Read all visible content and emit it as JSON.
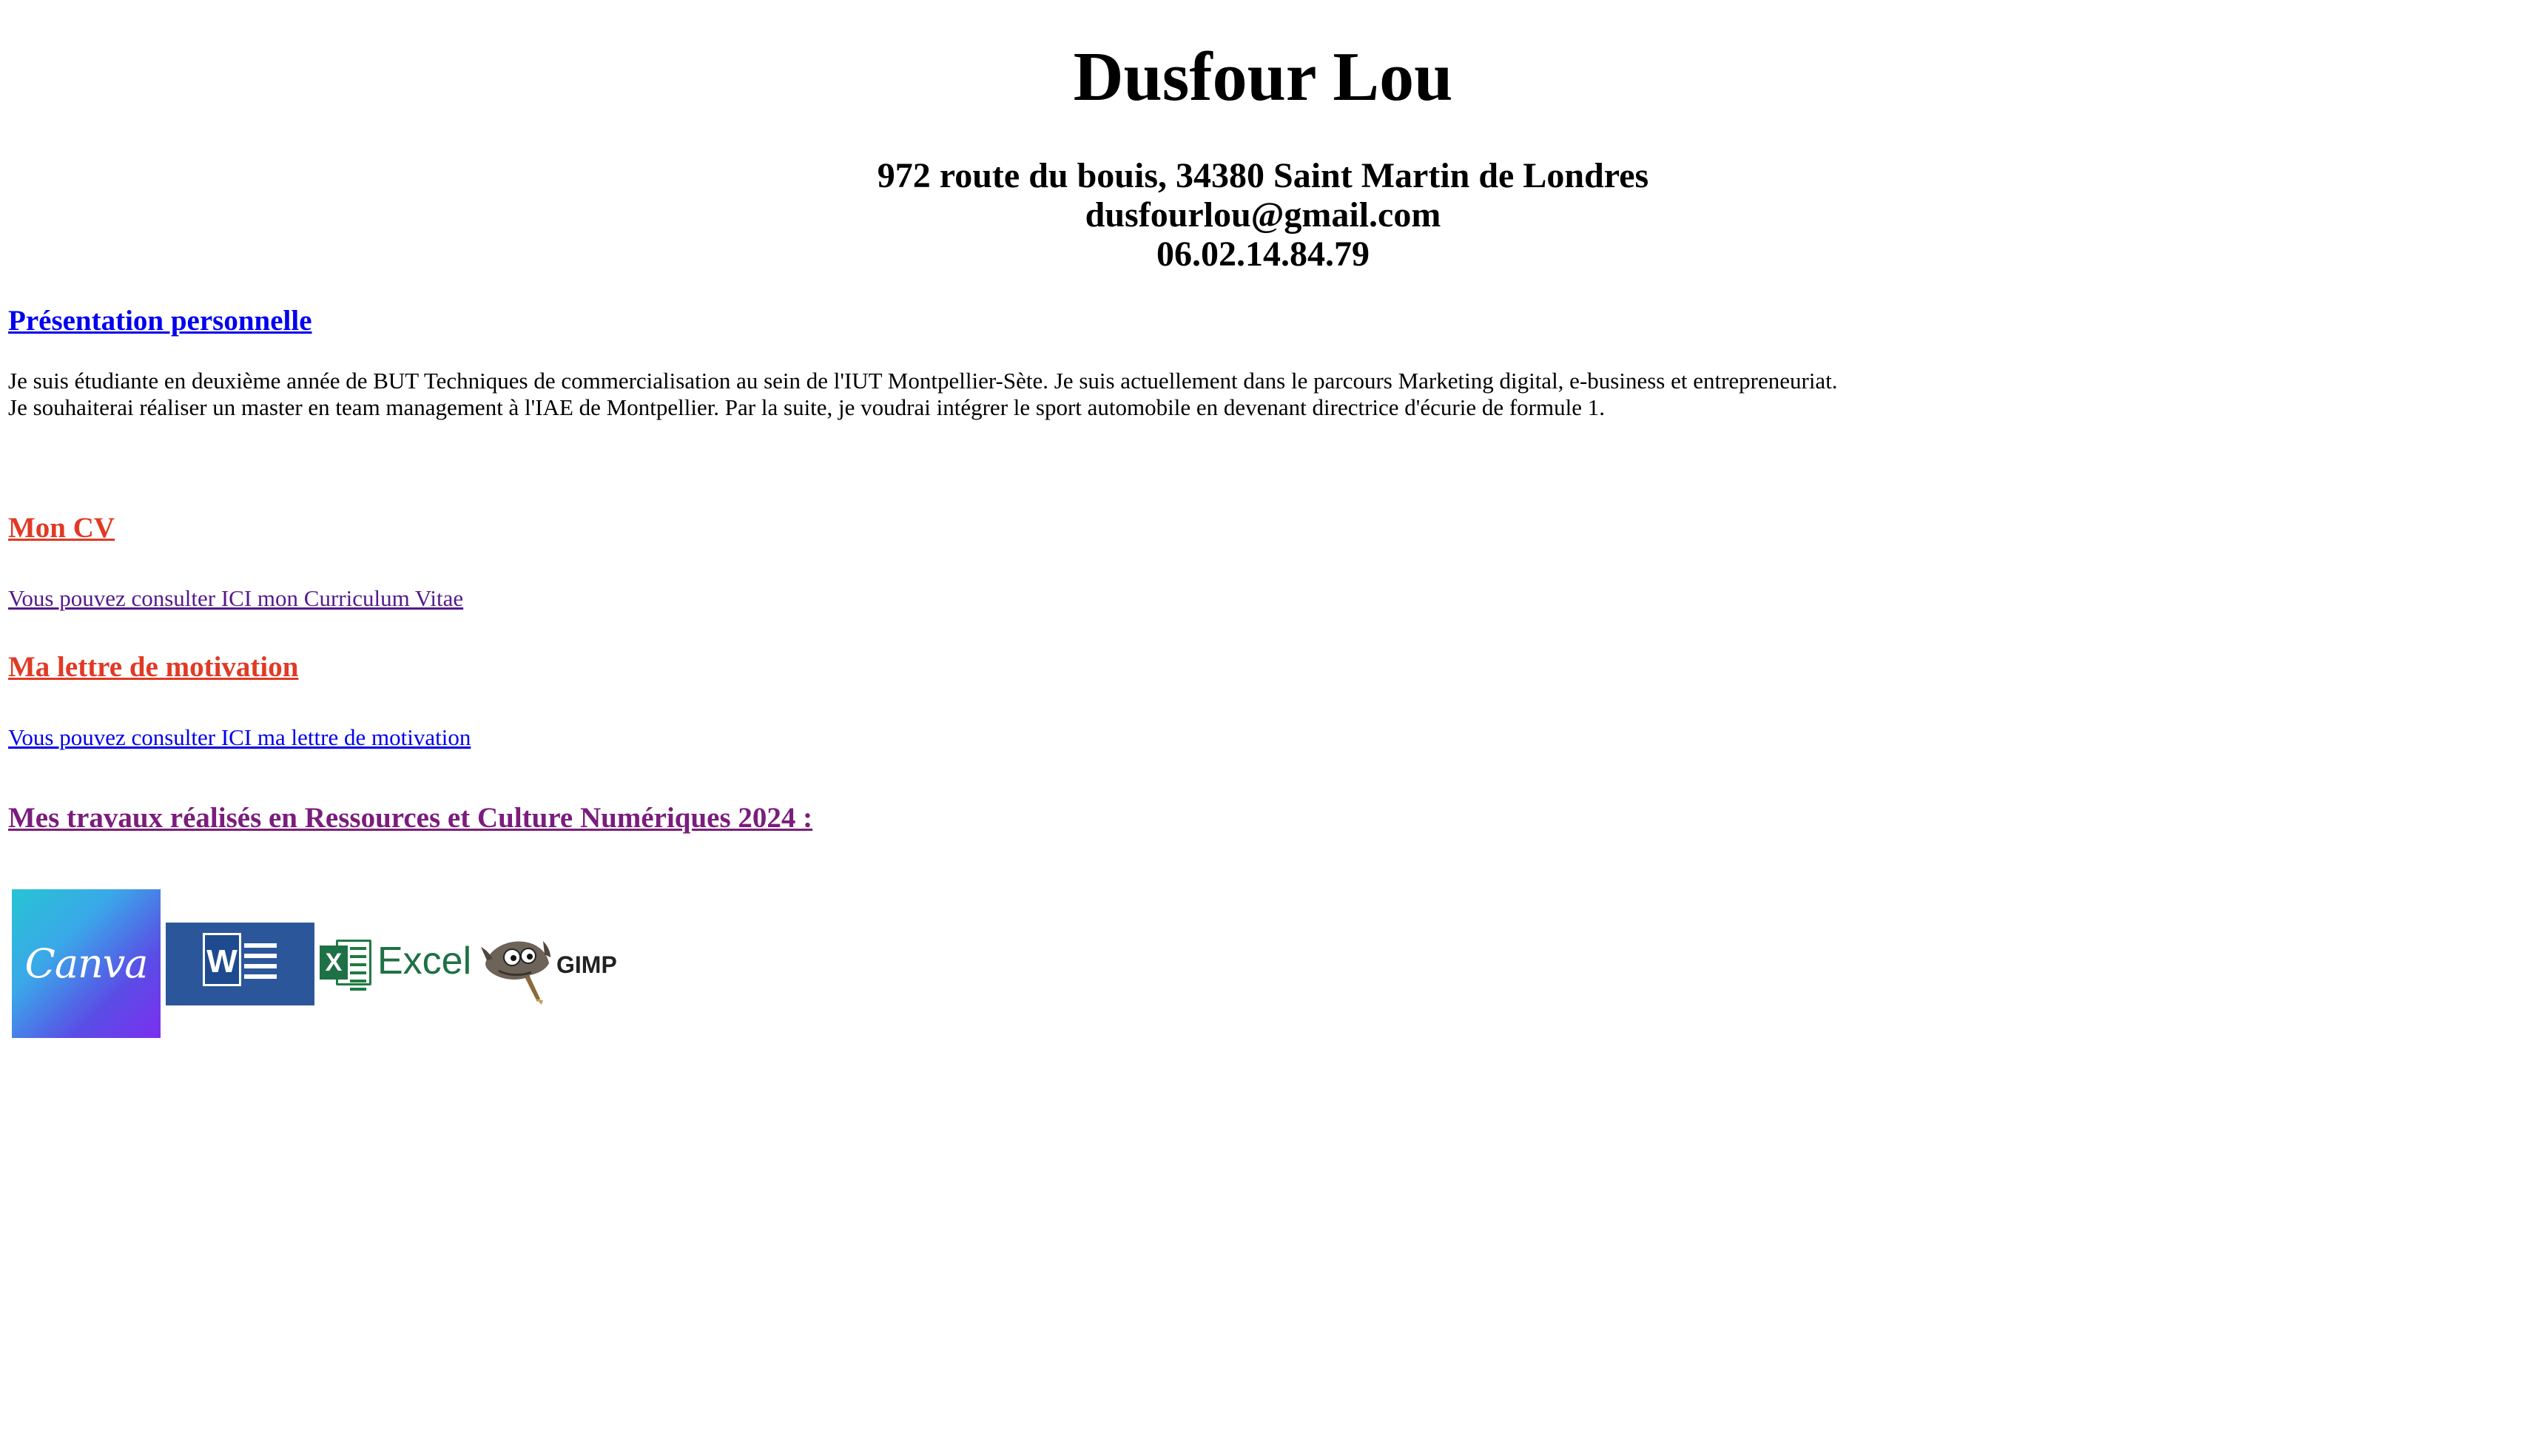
{
  "header": {
    "name": "Dusfour Lou",
    "address": "972 route du bouis, 34380 Saint Martin de Londres",
    "email": "dusfourlou@gmail.com",
    "phone": "06.02.14.84.79"
  },
  "presentation": {
    "heading": "Présentation personnelle",
    "line1": "Je suis étudiante en deuxième année de BUT Techniques de commercialisation au sein de l'IUT Montpellier-Sète. Je suis actuellement dans le parcours Marketing digital, e-business et entrepreneuriat.",
    "line2": "Je souhaiterai réaliser un master en team management à l'IAE de Montpellier. Par la suite, je voudrai intégrer le sport automobile en devenant directrice d'écurie de formule 1."
  },
  "cv": {
    "heading": "Mon CV",
    "link": "Vous pouvez consulter ICI mon Curriculum Vitae"
  },
  "lettre": {
    "heading": "Ma lettre de motivation",
    "link": "Vous pouvez consulter ICI ma lettre de motivation"
  },
  "travaux": {
    "heading": "Mes travaux réalisés en Ressources et Culture Numériques 2024 :",
    "logos": [
      {
        "name": "Canva",
        "icon": "canva-logo",
        "color": "#5a4de6"
      },
      {
        "name": "W",
        "icon": "word-logo",
        "color": "#2b579a"
      },
      {
        "name": "Excel",
        "icon": "excel-logo",
        "color": "#1e7145"
      },
      {
        "name": "GIMP",
        "icon": "gimp-logo",
        "color": "#7a6a52"
      }
    ]
  },
  "colors": {
    "link_blue": "#0000ee",
    "visited_purple": "#551a8b",
    "accent_red": "#e03a25",
    "heading_purple": "#7a1d7c"
  }
}
